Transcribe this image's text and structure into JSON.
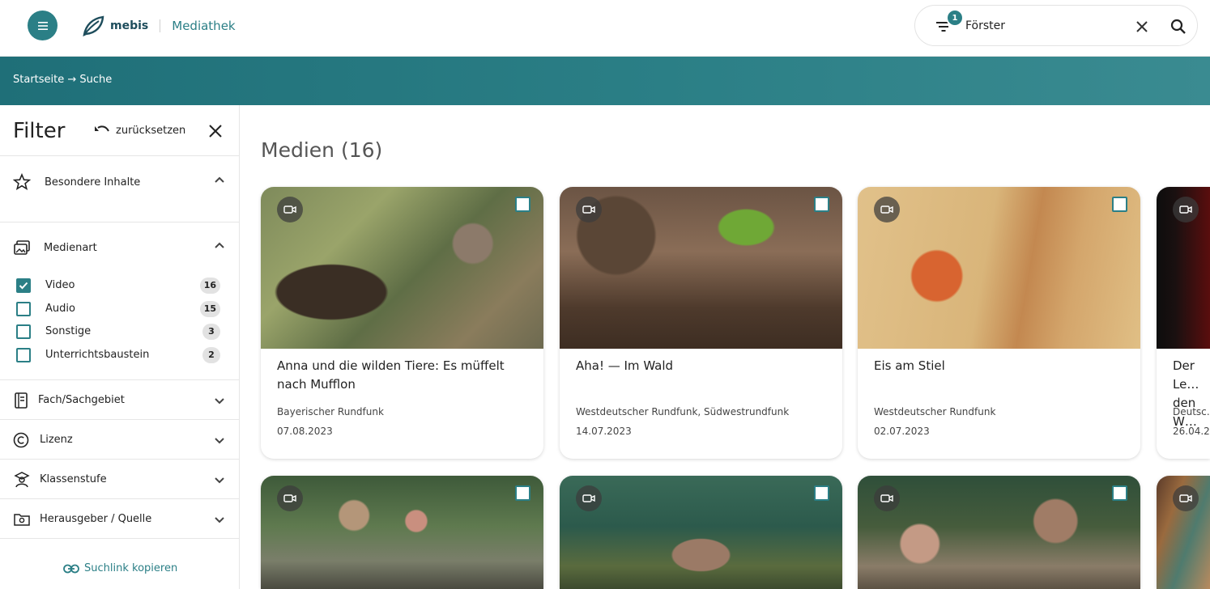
{
  "header": {
    "logo_text": "mebis",
    "logo_sub": "Mediathek",
    "filter_badge": "1",
    "search_value": "Förster",
    "icons": {
      "menu": "hamburger-icon",
      "filter": "filter-icon",
      "clear": "close-icon",
      "search": "search-icon"
    }
  },
  "breadcrumb": "Startseite → Suche",
  "sidebar": {
    "title": "Filter",
    "reset_label": "zurücksetzen",
    "sections": [
      {
        "label": "Besondere Inhalte",
        "icon": "star-icon",
        "expanded": true
      },
      {
        "label": "Medienart",
        "icon": "media-icon",
        "expanded": true
      },
      {
        "label": "Fach/Sachgebiet",
        "icon": "book-icon",
        "expanded": false
      },
      {
        "label": "Lizenz",
        "icon": "copyright-icon",
        "expanded": false
      },
      {
        "label": "Klassenstufe",
        "icon": "student-icon",
        "expanded": false
      },
      {
        "label": "Herausgeber / Quelle",
        "icon": "publisher-icon",
        "expanded": false
      }
    ],
    "media_options": [
      {
        "label": "Video",
        "count": "16",
        "checked": true
      },
      {
        "label": "Audio",
        "count": "15",
        "checked": false
      },
      {
        "label": "Sonstige",
        "count": "3",
        "checked": false
      },
      {
        "label": "Unterrichtsbaustein",
        "count": "2",
        "checked": false
      }
    ],
    "copy_link_label": "Suchlink kopieren"
  },
  "main": {
    "title": "Medien (16)",
    "cards": [
      {
        "title": "Anna und die wilden Tiere: Es müffelt nach Mufflon",
        "source": "Bayerischer Rundfunk",
        "date": "07.08.2023"
      },
      {
        "title": "Aha! — Im Wald",
        "source": "Westdeutscher Rundfunk, Südwestrundfunk",
        "date": "14.07.2023"
      },
      {
        "title": "Eis am Stiel",
        "source": "Westdeutscher Rundfunk",
        "date": "02.07.2023"
      },
      {
        "title": "Der Le… den W…",
        "source": "Deutsc…",
        "date": "26.04.2…"
      }
    ]
  },
  "colors": {
    "accent": "#2b7f86",
    "band_start": "#1f6f78",
    "band_end": "#3a8b91"
  }
}
